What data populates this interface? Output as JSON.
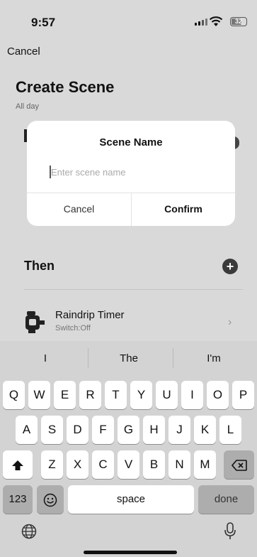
{
  "status_bar": {
    "time": "9:57",
    "battery": "32"
  },
  "nav": {
    "cancel_label": "Cancel"
  },
  "page": {
    "title": "Create Scene",
    "subtitle": "All day"
  },
  "then_section": {
    "heading": "Then"
  },
  "device": {
    "name": "Raindrip Timer",
    "status": "Switch:Off"
  },
  "dialog": {
    "title": "Scene Name",
    "input_placeholder": "Enter scene name",
    "input_value": "",
    "cancel_label": "Cancel",
    "confirm_label": "Confirm"
  },
  "keyboard": {
    "suggestions": [
      "I",
      "The",
      "I'm"
    ],
    "row1": [
      "Q",
      "W",
      "E",
      "R",
      "T",
      "Y",
      "U",
      "I",
      "O",
      "P"
    ],
    "row2": [
      "A",
      "S",
      "D",
      "F",
      "G",
      "H",
      "J",
      "K",
      "L"
    ],
    "row3": [
      "Z",
      "X",
      "C",
      "V",
      "B",
      "N",
      "M"
    ],
    "numbers_label": "123",
    "space_label": "space",
    "done_label": "done"
  },
  "icons": [
    "signal-icon",
    "wifi-icon",
    "battery-icon",
    "add-icon",
    "timer-device-icon",
    "chevron-right-icon",
    "shift-icon",
    "backspace-icon",
    "emoji-icon",
    "globe-icon",
    "microphone-icon"
  ]
}
